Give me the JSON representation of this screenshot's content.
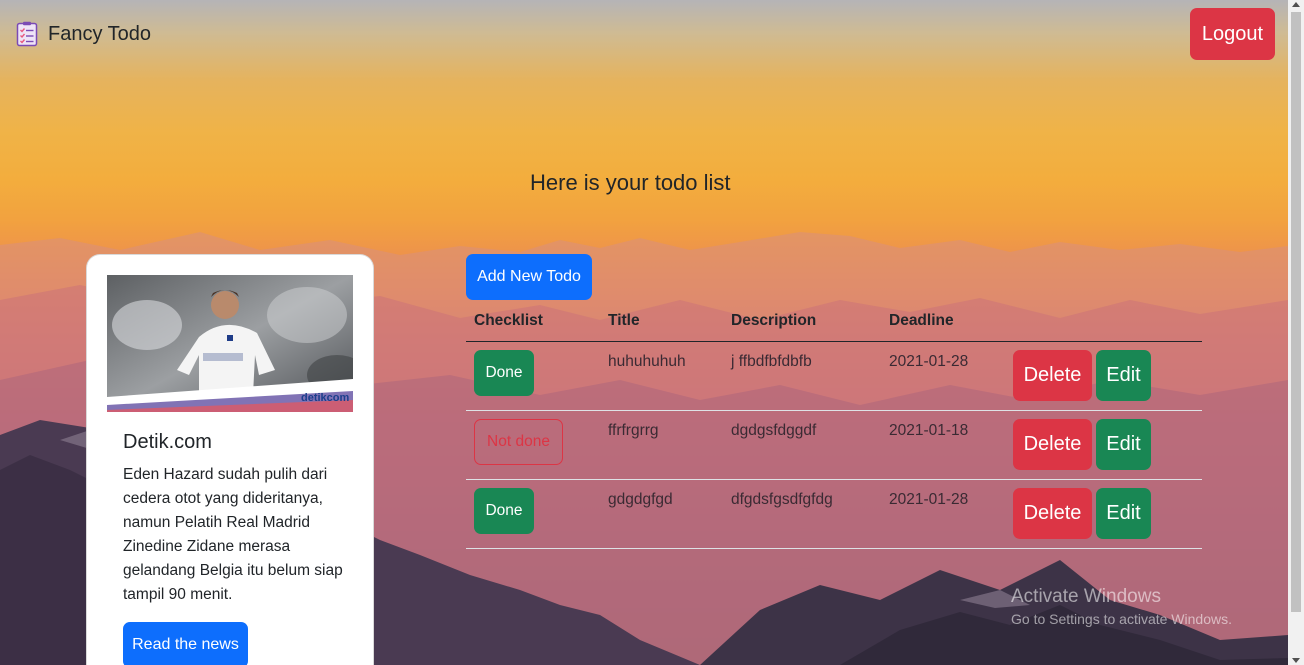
{
  "app": {
    "title": "Fancy Todo"
  },
  "header": {
    "logout_label": "Logout"
  },
  "main": {
    "heading": "Here is your todo list",
    "add_button_label": "Add New Todo",
    "columns": [
      "Checklist",
      "Title",
      "Description",
      "Deadline"
    ],
    "todos": [
      {
        "status": "Done",
        "done": true,
        "title": "huhuhuhuh",
        "description": "j ffbdfbfdbfb",
        "deadline": "2021-01-28",
        "delete_label": "Delete",
        "edit_label": "Edit"
      },
      {
        "status": "Not done",
        "done": false,
        "title": "ffrfrgrrg",
        "description": "dgdgsfdggdf",
        "deadline": "2021-01-18",
        "delete_label": "Delete",
        "edit_label": "Edit"
      },
      {
        "status": "Done",
        "done": true,
        "title": "gdgdgfgd",
        "description": "dfgdsfgsdfgfdg",
        "deadline": "2021-01-28",
        "delete_label": "Delete",
        "edit_label": "Edit"
      }
    ]
  },
  "news": {
    "image_watermark": "detikcom",
    "source": "Detik.com",
    "text": "Eden Hazard sudah pulih dari cedera otot yang dideritanya, namun Pelatih Real Madrid Zinedine Zidane merasa gelandang Belgia itu belum siap tampil 90 menit.",
    "read_label": "Read the news"
  },
  "watermark": {
    "title": "Activate Windows",
    "subtitle": "Go to Settings to activate Windows."
  },
  "colors": {
    "danger": "#dc3545",
    "success": "#198754",
    "primary": "#0d6efd"
  }
}
